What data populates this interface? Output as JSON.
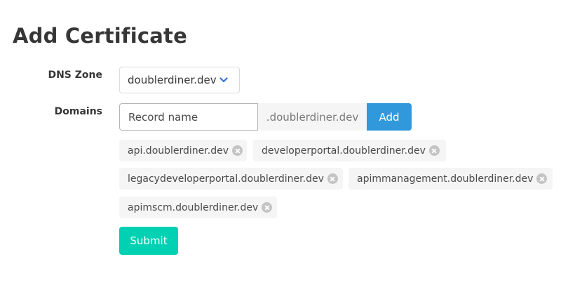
{
  "page": {
    "title": "Add Certificate"
  },
  "form": {
    "dns_zone": {
      "label": "DNS Zone",
      "selected": "doublerdiner.dev",
      "icon": "chevron-down-icon"
    },
    "domains": {
      "label": "Domains",
      "record_placeholder": "Record name",
      "record_value": "",
      "suffix": ".doublerdiner.dev",
      "add_label": "Add",
      "tags": [
        {
          "label": "api.doublerdiner.dev",
          "icon": "delete-icon"
        },
        {
          "label": "developerportal.doublerdiner.dev",
          "icon": "delete-icon"
        },
        {
          "label": "legacydeveloperportal.doublerdiner.dev",
          "icon": "delete-icon"
        },
        {
          "label": "apimmanagement.doublerdiner.dev",
          "icon": "delete-icon"
        },
        {
          "label": "apimscm.doublerdiner.dev",
          "icon": "delete-icon"
        }
      ]
    },
    "submit_label": "Submit"
  },
  "colors": {
    "add_button": "#3298dc",
    "submit_button": "#00d1b2",
    "tag_background": "#f5f5f5",
    "chevron": "#3273dc"
  }
}
